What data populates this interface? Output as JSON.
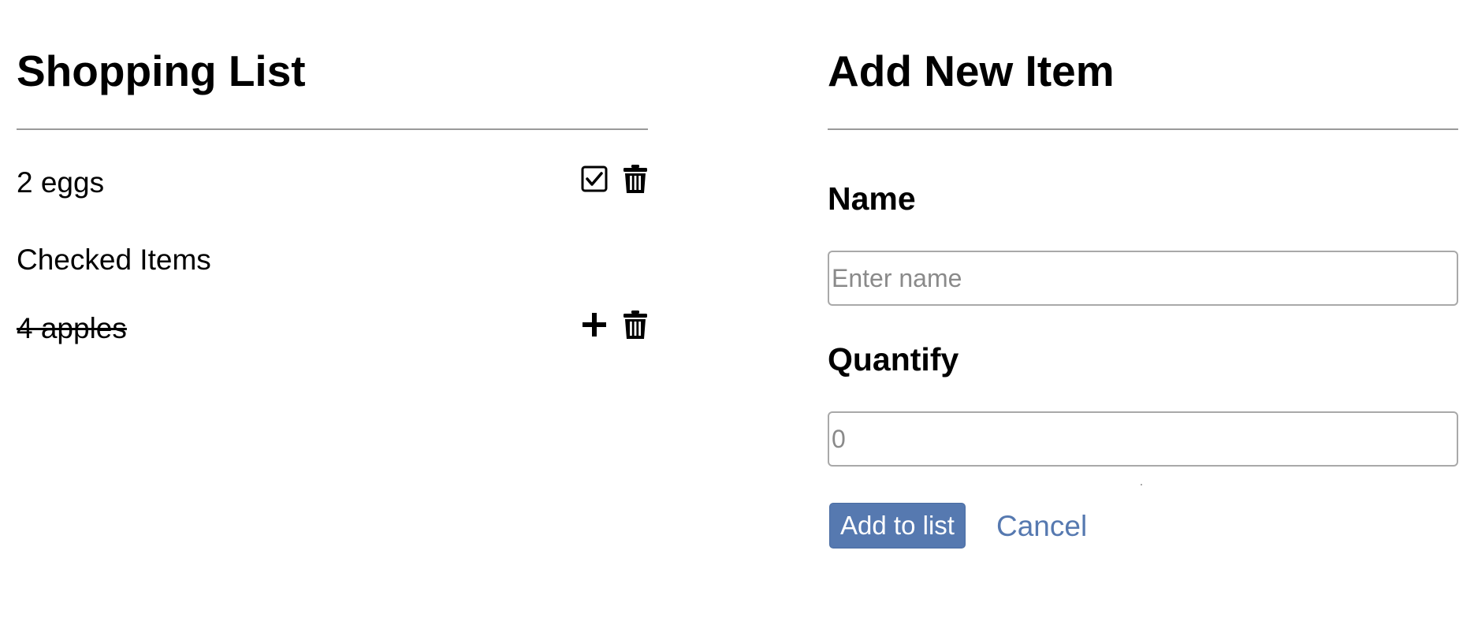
{
  "shopping_list": {
    "title": "Shopping List",
    "items": [
      {
        "label": "2 eggs",
        "actions": [
          "check-icon",
          "trash-icon"
        ]
      }
    ],
    "checked_section_title": "Checked Items",
    "checked_items": [
      {
        "label": "4 apples",
        "actions": [
          "plus-icon",
          "trash-icon"
        ]
      }
    ]
  },
  "add_item": {
    "title": "Add New Item",
    "name_label": "Name",
    "name_placeholder": "Enter name",
    "name_value": "",
    "quantity_label": "Quantify",
    "quantity_placeholder": "0",
    "quantity_value": "",
    "submit_label": "Add to list",
    "cancel_label": "Cancel"
  },
  "colors": {
    "accent": "#5679b0",
    "rule": "#9a9a9a",
    "input_border": "#a9a9a9"
  }
}
